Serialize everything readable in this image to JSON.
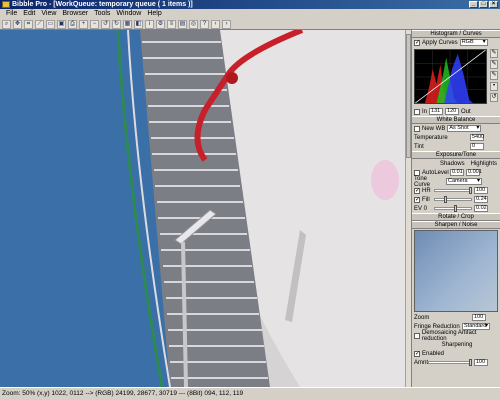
{
  "window": {
    "title": "Bibble Pro - [WorkQueue: temporary queue ( 1 items )]"
  },
  "menu": [
    "File",
    "Edit",
    "View",
    "Browser",
    "Tools",
    "Window",
    "Help"
  ],
  "histogram_panel": {
    "title": "Histogram / Curves",
    "apply_curves_label": "Apply Curves",
    "channel": "RGB",
    "in_label": "In",
    "in_value": "131",
    "out_label": "Out",
    "out_value": "120"
  },
  "white_balance": {
    "title": "White Balance",
    "new_wb_label": "New WB",
    "preset": "As Shot",
    "temperature_label": "Temperature",
    "temperature_value": "5400",
    "tint_label": "Tint",
    "tint_value": "0"
  },
  "exposure": {
    "title": "Exposure/Tone",
    "shadows_label": "Shadows",
    "highlights_label": "Highlights",
    "autolevel_label": "AutoLevel",
    "shadows_value": "0.01",
    "highlights_value": "0.001",
    "tone_curve_label": "Tone Curve",
    "tone_curve_value": "Camera",
    "hr_label": "HR",
    "hr_value": "100",
    "fill_label": "Fill",
    "fill_value": "0.24",
    "ev_label": "EV 0",
    "ev_value": "0.02"
  },
  "rotate_panel": {
    "title": "Rotate / Crop"
  },
  "sharpen_panel": {
    "title": "Sharpen / Noise",
    "zoom_label": "Zoom",
    "zoom_value": "100",
    "fringe_label": "Fringe Reduction",
    "fringe_value": "Standard",
    "demosaic_label": "Demosaicing Artifact reduction",
    "sharpening_title": "Sharpening",
    "enabled_label": "Enabled",
    "amount_label": "Amnt",
    "amount_value": "100"
  },
  "status": {
    "text": "Zoom:  50% (x,y) 1022, 0112 --> (RGB) 24199, 28677, 30719 --- (8Bit) 094, 112, 119"
  },
  "colors": {
    "sky": "#3b6fa8",
    "tank": "#e6e3e4",
    "rail_red": "#c8202a",
    "rail_green": "#2e8a55"
  }
}
